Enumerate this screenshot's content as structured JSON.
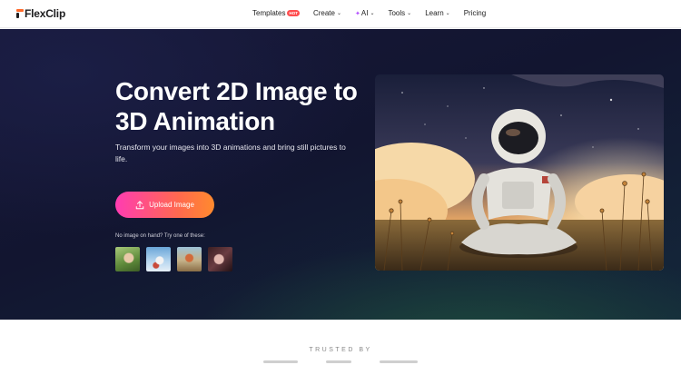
{
  "header": {
    "logo_text": "FlexClip",
    "nav": [
      {
        "label": "Templates",
        "badge": "HOT"
      },
      {
        "label": "Create",
        "chevron": true
      },
      {
        "label": "AI",
        "chevron": true,
        "icon": "sparkle-icon"
      },
      {
        "label": "Tools",
        "chevron": true
      },
      {
        "label": "Learn",
        "chevron": true
      },
      {
        "label": "Pricing"
      }
    ]
  },
  "hero": {
    "title": "Convert 2D Image to 3D Animation",
    "subtitle": "Transform your images into 3D animations and bring still pictures to life.",
    "upload_label": "Upload Image",
    "upload_icon": "upload-icon",
    "try_label": "No image on hand? Try one of these:",
    "samples": [
      "sample-image-1",
      "sample-image-2",
      "sample-image-3",
      "sample-image-4"
    ]
  },
  "trusted": {
    "label": "TRUSTED BY"
  },
  "colors": {
    "accent_start": "#ff3cb2",
    "accent_end": "#ff8a2e",
    "hero_bg": "#141733",
    "badge": "#ff4d4f"
  }
}
